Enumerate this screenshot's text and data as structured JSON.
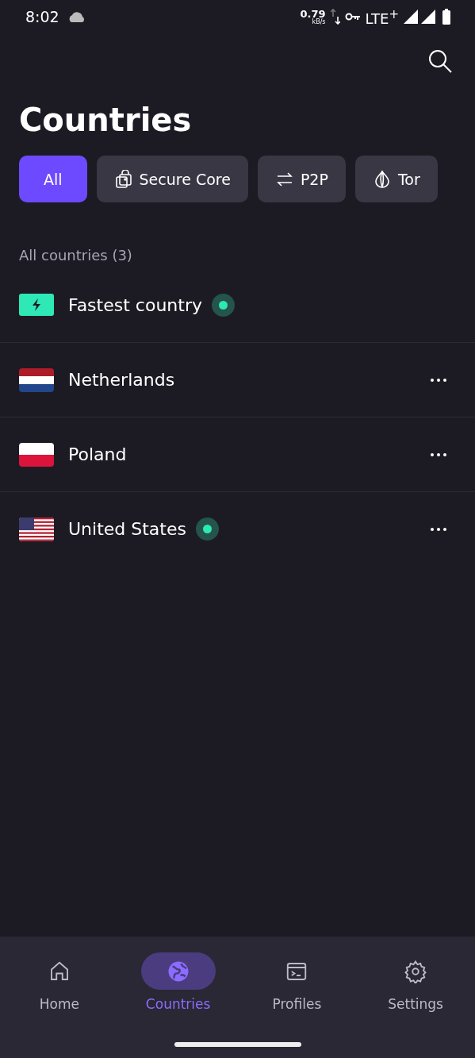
{
  "status_bar": {
    "time": "8:02",
    "speed": "0.79",
    "speed_unit": "kB/s",
    "network": "LTE$^{+}$"
  },
  "title": "Countries",
  "filters": [
    {
      "label": "All",
      "selected": true
    },
    {
      "label": "Secure Core",
      "selected": false
    },
    {
      "label": "P2P",
      "selected": false
    },
    {
      "label": "Tor",
      "selected": false
    }
  ],
  "section_label": "All countries (3)",
  "rows": [
    {
      "kind": "fastest",
      "name": "Fastest country",
      "connected": true
    },
    {
      "kind": "country",
      "name": "Netherlands",
      "connected": false
    },
    {
      "kind": "country",
      "name": "Poland",
      "connected": false
    },
    {
      "kind": "country",
      "name": "United States",
      "connected": true
    }
  ],
  "nav": [
    {
      "label": "Home",
      "selected": false
    },
    {
      "label": "Countries",
      "selected": true
    },
    {
      "label": "Profiles",
      "selected": false
    },
    {
      "label": "Settings",
      "selected": false
    }
  ]
}
